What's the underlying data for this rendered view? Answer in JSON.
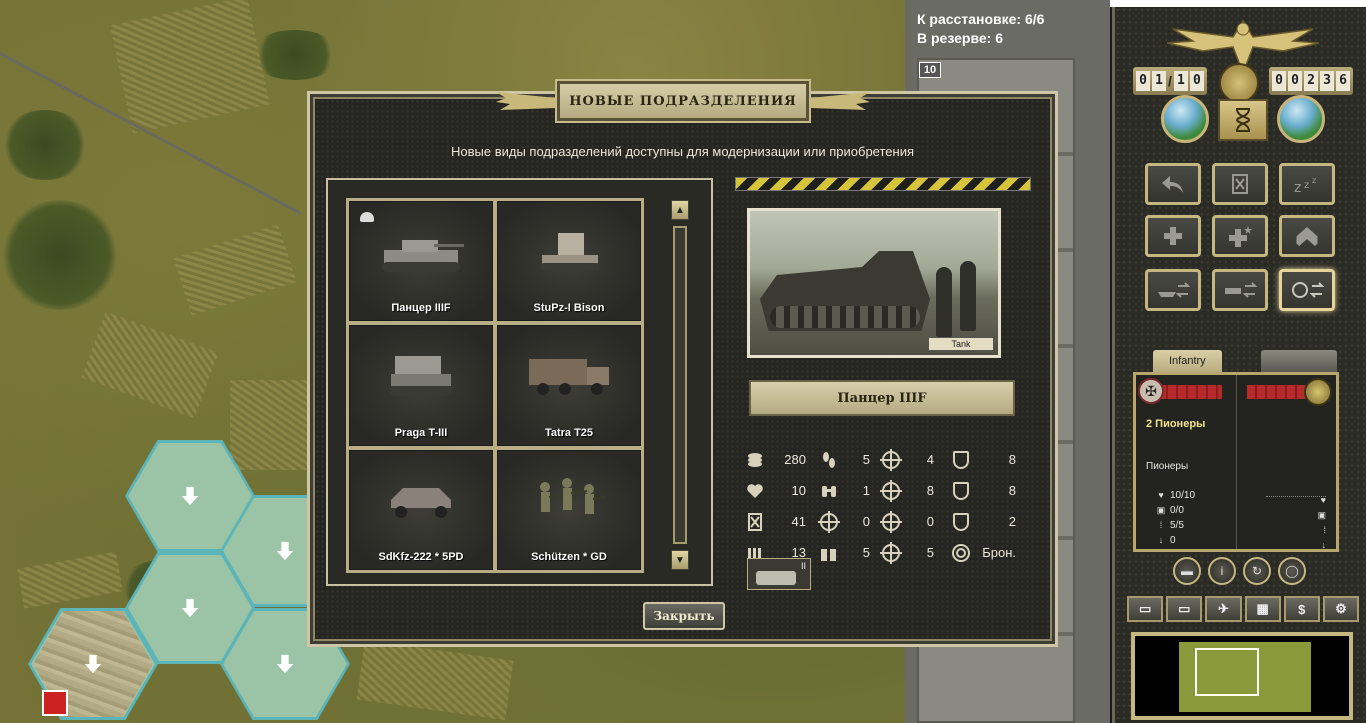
{
  "deploy": {
    "to_deploy": "К расстановке: 6/6",
    "in_reserve": "В резерве: 6",
    "slot_number": "10"
  },
  "right_panel": {
    "turn_digits": [
      "0",
      "1",
      "1",
      "0"
    ],
    "turn_separator": "/",
    "score_digits": [
      "0",
      "0",
      "2",
      "3",
      "6"
    ],
    "unit_tab_label": "Infantry",
    "unit_name": "2 Пионеры",
    "unit_type": "Пионеры",
    "unit_stats": [
      {
        "icon": "heart-icon",
        "value": "10/10"
      },
      {
        "icon": "ammo-icon",
        "value": "0/0"
      },
      {
        "icon": "fuel-icon",
        "value": "5/5"
      },
      {
        "icon": "arrow-down-icon",
        "value": "0"
      }
    ],
    "bottom_buttons": [
      "tank-icon",
      "truck-icon",
      "plane-icon",
      "grid-icon",
      "dollar-icon",
      "gear-icon"
    ],
    "bottom_dollar": "$"
  },
  "dialog": {
    "title": "НОВЫЕ ПОДРАЗДЕЛЕНИЯ",
    "subtitle": "Новые виды подразделений доступны для модернизации или приобретения",
    "units": [
      {
        "name": "Панцер IIIF",
        "icon": "panzer-tank-icon"
      },
      {
        "name": "StuPz-I Bison",
        "icon": "bison-gun-icon"
      },
      {
        "name": "Praga T-III",
        "icon": "praga-tank-icon"
      },
      {
        "name": "Tatra T25",
        "icon": "truck-icon"
      },
      {
        "name": "SdKfz-222 * 5PD",
        "icon": "armored-car-icon"
      },
      {
        "name": "Schützen * GD",
        "icon": "infantry-icon"
      }
    ],
    "photo_caption": "Tank",
    "selected_unit": "Панцер IIIF",
    "stats": [
      [
        {
          "icon": "coins-icon",
          "value": "280"
        },
        {
          "icon": "footsteps-icon",
          "value": "5"
        },
        {
          "icon": "infantry-target-icon",
          "value": "4"
        },
        {
          "icon": "tank-shield-icon",
          "value": "8"
        }
      ],
      [
        {
          "icon": "heart-icon",
          "value": "10"
        },
        {
          "icon": "binoculars-icon",
          "value": "1"
        },
        {
          "icon": "tank-target-icon",
          "value": "8"
        },
        {
          "icon": "plane-shield-icon",
          "value": "8"
        }
      ],
      [
        {
          "icon": "ammo-icon",
          "value": "41"
        },
        {
          "icon": "crosshair-icon",
          "value": "0"
        },
        {
          "icon": "plane-target-icon",
          "value": "0"
        },
        {
          "icon": "infantry-shield-icon",
          "value": "2"
        }
      ],
      [
        {
          "icon": "fuel-icon",
          "value": "13"
        },
        {
          "icon": "fuel-cans-icon",
          "value": "5"
        },
        {
          "icon": "naval-target-icon",
          "value": "5"
        },
        {
          "icon": "armor-type-icon",
          "value": "Брон."
        }
      ]
    ],
    "mini_icon_label": "II",
    "close_label": "Закрыть"
  },
  "colors": {
    "hex_border": "#5ab4b8",
    "gold": "#c6b680",
    "unit_name": "#f0e38a"
  }
}
